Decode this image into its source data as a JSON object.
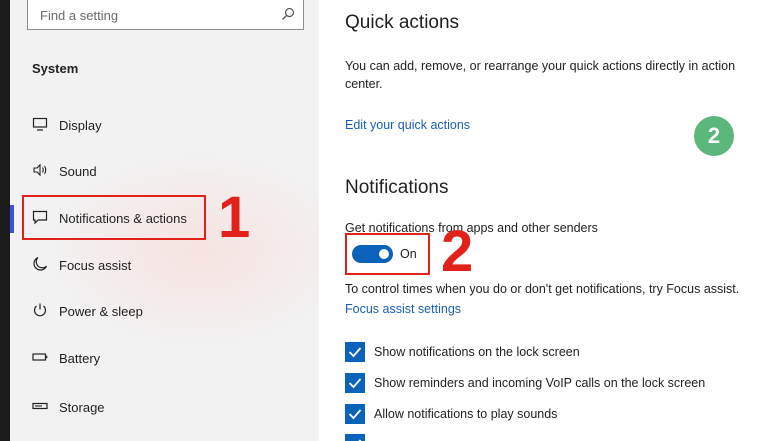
{
  "search": {
    "placeholder": "Find a setting",
    "icon": "search-icon"
  },
  "sidebar": {
    "section_title": "System",
    "items": [
      {
        "label": "Display",
        "icon": "display-icon"
      },
      {
        "label": "Sound",
        "icon": "sound-icon"
      },
      {
        "label": "Notifications & actions",
        "icon": "notification-icon",
        "selected": true
      },
      {
        "label": "Focus assist",
        "icon": "moon-icon"
      },
      {
        "label": "Power & sleep",
        "icon": "power-icon"
      },
      {
        "label": "Battery",
        "icon": "battery-icon"
      },
      {
        "label": "Storage",
        "icon": "storage-icon"
      }
    ]
  },
  "main": {
    "quick_actions_title": "Quick actions",
    "quick_actions_desc": "You can add, remove, or rearrange your quick actions directly in action center.",
    "edit_link": "Edit your quick actions",
    "notifications_title": "Notifications",
    "get_notifications_label": "Get notifications from apps and other senders",
    "toggle_state": "On",
    "focus_hint": "To control times when you do or don't get notifications, try Focus assist.",
    "focus_link": "Focus assist settings",
    "checkboxes": [
      {
        "label": "Show notifications on the lock screen",
        "checked": true
      },
      {
        "label": "Show reminders and incoming VoIP calls on the lock screen",
        "checked": true
      },
      {
        "label": "Allow notifications to play sounds",
        "checked": true
      },
      {
        "label": "",
        "checked": true
      }
    ]
  },
  "annotations": {
    "marker_1": "1",
    "marker_2": "2",
    "badge_2": "2"
  },
  "colors": {
    "accent": "#0b62b9",
    "highlight_red": "#e3211b",
    "badge_green": "#5bb77c",
    "link": "#1a5fb4"
  }
}
